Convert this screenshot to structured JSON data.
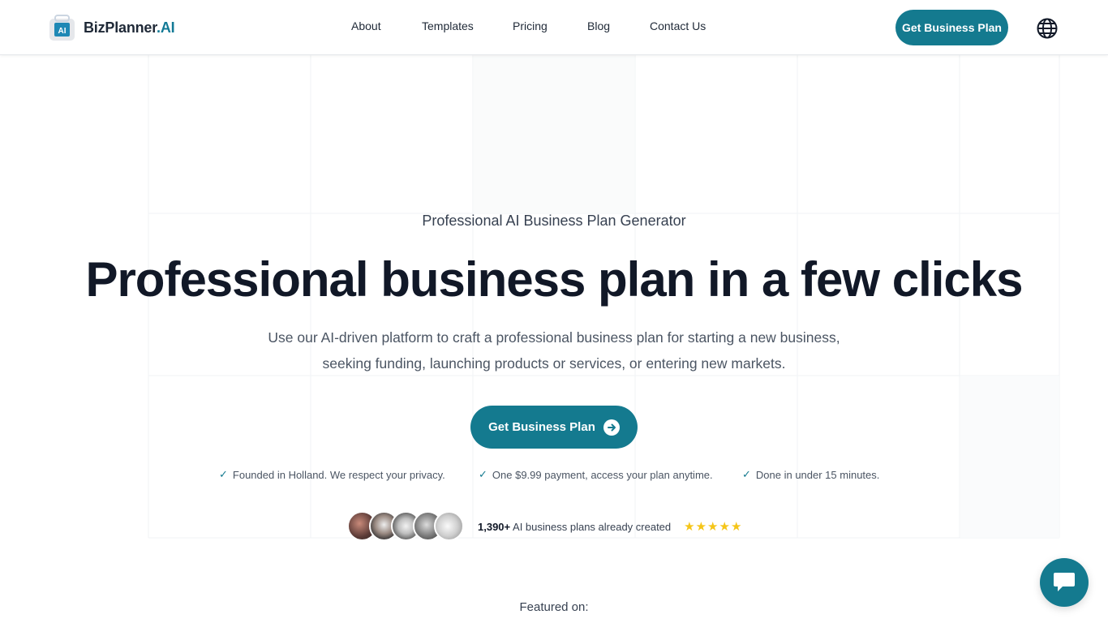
{
  "brand": {
    "name": "BizPlanner",
    "suffix": ".AI",
    "logo_badge": "AI",
    "accent": "#147a8f"
  },
  "nav": {
    "items": [
      "About",
      "Templates",
      "Pricing",
      "Blog",
      "Contact Us"
    ]
  },
  "header": {
    "cta_label": "Get Business Plan",
    "language_icon": "globe-icon"
  },
  "hero": {
    "eyebrow": "Professional AI Business Plan Generator",
    "title": "Professional business plan in a few clicks",
    "description_line1": "Use our AI-driven platform to craft a professional business plan for starting a new business,",
    "description_line2": "seeking funding, launching products or services, or entering new markets.",
    "cta_label": "Get Business Plan",
    "cta_icon": "arrow-right-circle-icon"
  },
  "features": [
    "Founded in Holland. We respect your privacy.",
    "One $9.99 payment, access your plan anytime.",
    "Done in under 15 minutes."
  ],
  "social_proof": {
    "count": "1,390+",
    "text": "AI business plans already created",
    "stars": "★★★★★",
    "rating": 5
  },
  "featured": {
    "label": "Featured on:"
  },
  "chat": {
    "icon": "chat-bubble-icon"
  }
}
